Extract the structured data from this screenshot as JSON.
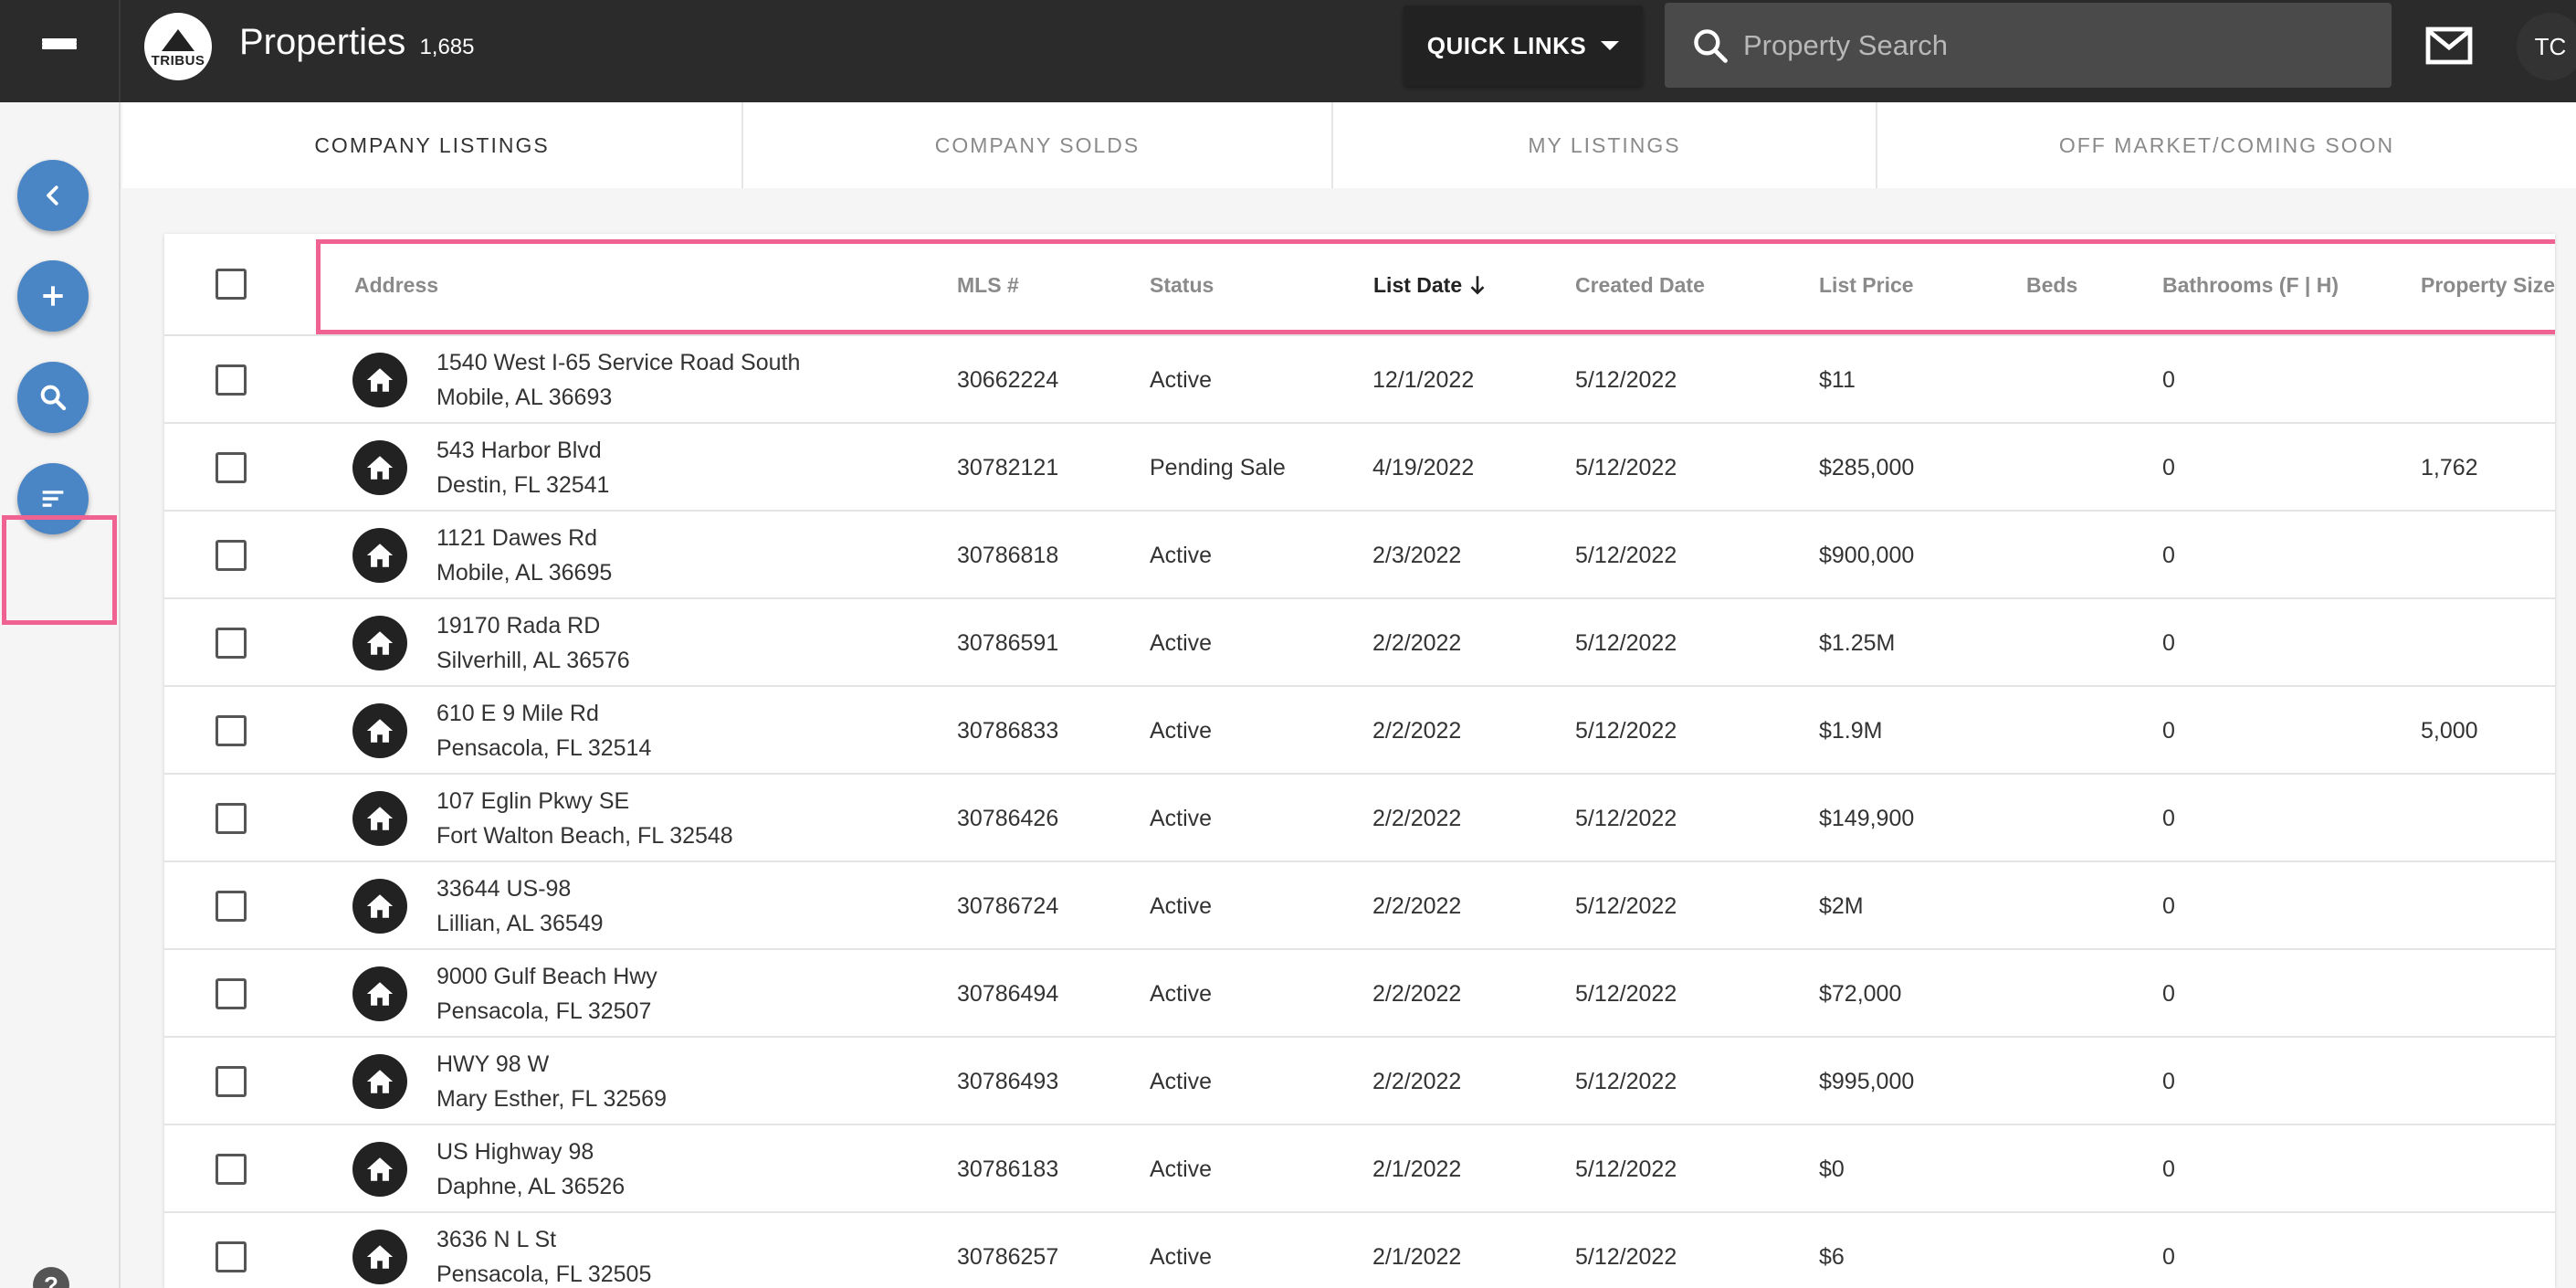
{
  "header": {
    "title": "Properties",
    "count": "1,685",
    "logo_text": "TRIBUS",
    "quick_links_label": "QUICK LINKS",
    "search_placeholder": "Property Search",
    "avatar_initials": "TC"
  },
  "icons": {
    "menu": "hamburger-menu-icon",
    "back": "chevron-left-icon",
    "add": "plus-icon",
    "search": "search-icon",
    "sort": "sort-filter-icon",
    "mail": "mail-icon",
    "property": "house-icon",
    "help": "help-icon"
  },
  "colors": {
    "topbar": "#2b2b2b",
    "fab": "#4a86c5",
    "highlight": "#f06292"
  },
  "tabs": [
    {
      "label": "COMPANY LISTINGS",
      "active": true
    },
    {
      "label": "COMPANY SOLDS",
      "active": false
    },
    {
      "label": "MY LISTINGS",
      "active": false
    },
    {
      "label": "OFF MARKET/COMING SOON",
      "active": false
    }
  ],
  "table": {
    "columns": {
      "address": "Address",
      "mls": "MLS #",
      "status": "Status",
      "list_date": "List Date",
      "created_date": "Created Date",
      "list_price": "List Price",
      "beds": "Beds",
      "bathrooms": "Bathrooms (F | H)",
      "property_size": "Property Size"
    },
    "sorted_by": "list_date",
    "sort_direction": "descending",
    "rows": [
      {
        "street": "1540 West I-65 Service Road South",
        "city": "Mobile, AL 36693",
        "mls": "30662224",
        "status": "Active",
        "list_date": "12/1/2022",
        "created_date": "5/12/2022",
        "list_price": "$11",
        "beds": "",
        "bathrooms": "0",
        "property_size": ""
      },
      {
        "street": "543 Harbor Blvd",
        "city": "Destin, FL 32541",
        "mls": "30782121",
        "status": "Pending Sale",
        "list_date": "4/19/2022",
        "created_date": "5/12/2022",
        "list_price": "$285,000",
        "beds": "",
        "bathrooms": "0",
        "property_size": "1,762"
      },
      {
        "street": "1121 Dawes Rd",
        "city": "Mobile, AL 36695",
        "mls": "30786818",
        "status": "Active",
        "list_date": "2/3/2022",
        "created_date": "5/12/2022",
        "list_price": "$900,000",
        "beds": "",
        "bathrooms": "0",
        "property_size": ""
      },
      {
        "street": "19170 Rada RD",
        "city": "Silverhill, AL 36576",
        "mls": "30786591",
        "status": "Active",
        "list_date": "2/2/2022",
        "created_date": "5/12/2022",
        "list_price": "$1.25M",
        "beds": "",
        "bathrooms": "0",
        "property_size": ""
      },
      {
        "street": "610 E 9 Mile Rd",
        "city": "Pensacola, FL 32514",
        "mls": "30786833",
        "status": "Active",
        "list_date": "2/2/2022",
        "created_date": "5/12/2022",
        "list_price": "$1.9M",
        "beds": "",
        "bathrooms": "0",
        "property_size": "5,000"
      },
      {
        "street": "107 Eglin Pkwy SE",
        "city": "Fort Walton Beach, FL 32548",
        "mls": "30786426",
        "status": "Active",
        "list_date": "2/2/2022",
        "created_date": "5/12/2022",
        "list_price": "$149,900",
        "beds": "",
        "bathrooms": "0",
        "property_size": ""
      },
      {
        "street": "33644 US-98",
        "city": "Lillian, AL 36549",
        "mls": "30786724",
        "status": "Active",
        "list_date": "2/2/2022",
        "created_date": "5/12/2022",
        "list_price": "$2M",
        "beds": "",
        "bathrooms": "0",
        "property_size": ""
      },
      {
        "street": "9000 Gulf Beach Hwy",
        "city": "Pensacola, FL 32507",
        "mls": "30786494",
        "status": "Active",
        "list_date": "2/2/2022",
        "created_date": "5/12/2022",
        "list_price": "$72,000",
        "beds": "",
        "bathrooms": "0",
        "property_size": ""
      },
      {
        "street": "HWY 98 W",
        "city": "Mary Esther, FL 32569",
        "mls": "30786493",
        "status": "Active",
        "list_date": "2/2/2022",
        "created_date": "5/12/2022",
        "list_price": "$995,000",
        "beds": "",
        "bathrooms": "0",
        "property_size": ""
      },
      {
        "street": "US Highway 98",
        "city": "Daphne, AL 36526",
        "mls": "30786183",
        "status": "Active",
        "list_date": "2/1/2022",
        "created_date": "5/12/2022",
        "list_price": "$0",
        "beds": "",
        "bathrooms": "0",
        "property_size": ""
      },
      {
        "street": "3636 N L St",
        "city": "Pensacola, FL 32505",
        "mls": "30786257",
        "status": "Active",
        "list_date": "2/1/2022",
        "created_date": "5/12/2022",
        "list_price": "$6",
        "beds": "",
        "bathrooms": "0",
        "property_size": ""
      }
    ]
  }
}
